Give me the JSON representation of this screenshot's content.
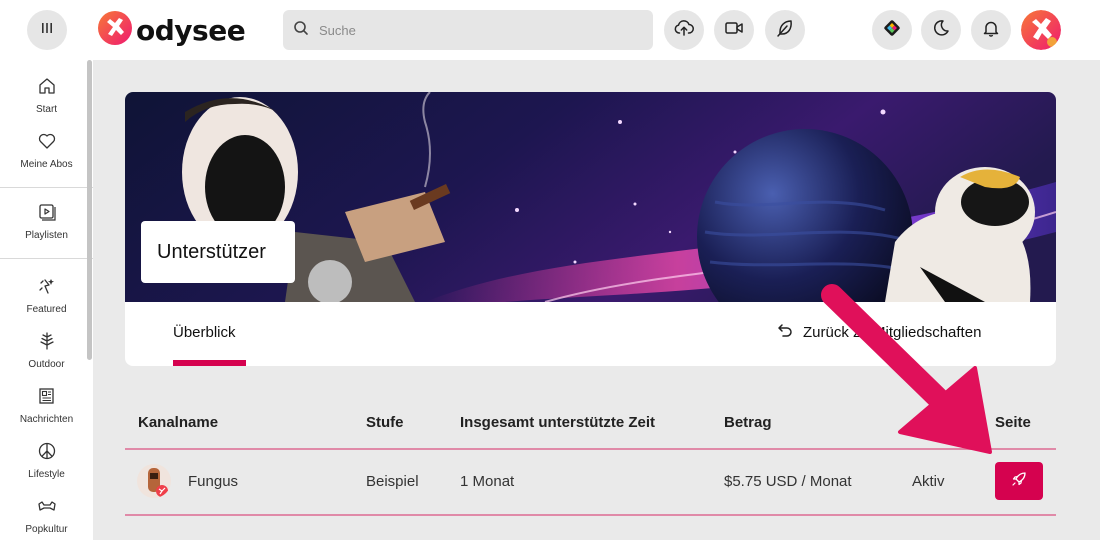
{
  "header": {
    "logo_text": "odysee",
    "search_placeholder": "Suche",
    "icons": [
      "menu-icon",
      "search-icon",
      "upload-icon",
      "video-camera-icon",
      "feather-icon",
      "wallet-icon",
      "moon-icon",
      "bell-icon"
    ]
  },
  "sidebar": {
    "items": [
      {
        "label": "Start",
        "icon": "home-icon"
      },
      {
        "label": "Meine Abos",
        "icon": "heart-icon"
      },
      {
        "label": "Playlisten",
        "icon": "playlist-icon"
      },
      {
        "label": "Featured",
        "icon": "featured-icon"
      },
      {
        "label": "Outdoor",
        "icon": "tree-icon"
      },
      {
        "label": "Nachrichten",
        "icon": "newspaper-icon"
      },
      {
        "label": "Lifestyle",
        "icon": "peace-icon"
      },
      {
        "label": "Popkultur",
        "icon": "popculture-icon"
      }
    ]
  },
  "page": {
    "title": "Unterstützer",
    "tab_overview": "Überblick",
    "back_link": "Zurück zu Mitgliedschaften"
  },
  "table": {
    "columns": [
      "Kanalname",
      "Stufe",
      "Insgesamt unterstützte Zeit",
      "Betrag",
      "Status",
      "Seite"
    ],
    "rows": [
      {
        "channel": "Fungus",
        "tier": "Beispiel",
        "time": "1 Monat",
        "amount": "$5.75 USD / Monat",
        "status": "Aktiv"
      }
    ]
  },
  "colors": {
    "accent": "#d5024f",
    "header_bg": "#ffffff",
    "page_bg": "#eaeaea",
    "annotation_arrow": "#e0105a"
  }
}
